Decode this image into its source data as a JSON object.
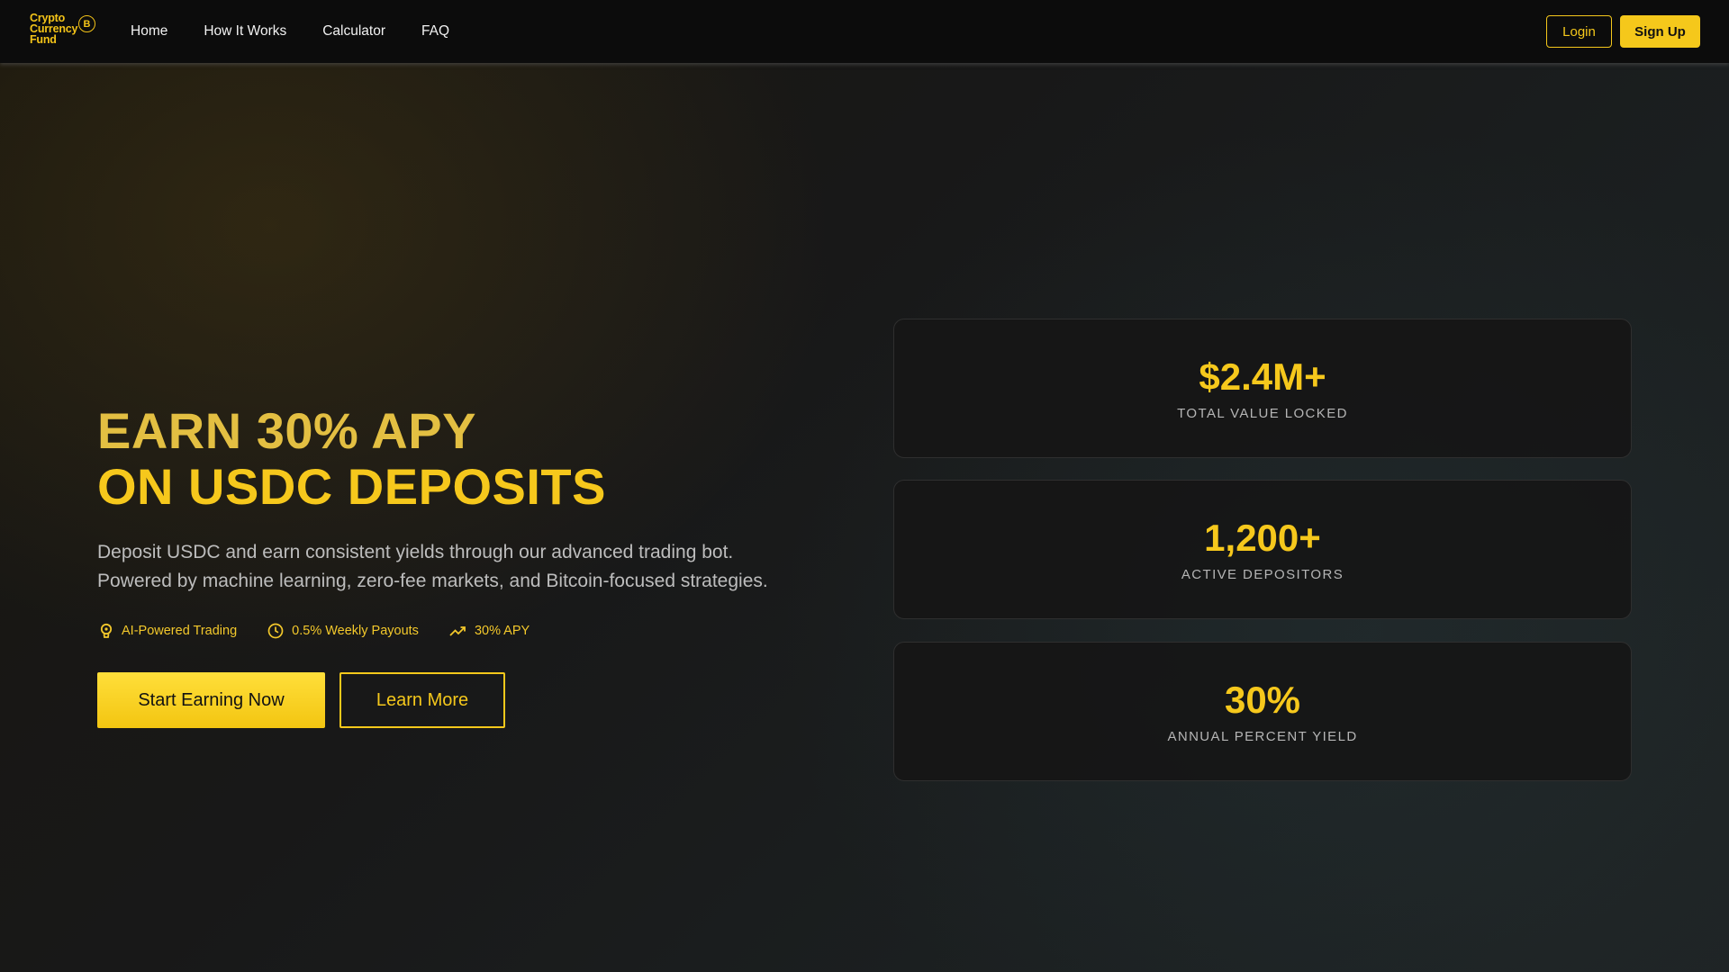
{
  "brand": {
    "logo_lines": [
      "Crypto",
      "Currency",
      "Fund"
    ],
    "coin_glyph": "B",
    "accent_color": "#f5c81b"
  },
  "nav": {
    "links": [
      "Home",
      "How It Works",
      "Calculator",
      "FAQ"
    ],
    "login_label": "Login",
    "signup_label": "Sign Up"
  },
  "hero": {
    "title_line1": "EARN 30% APY",
    "title_line2": "ON USDC DEPOSITS",
    "subtitle_line1": "Deposit USDC and earn consistent yields through our advanced trading bot.",
    "subtitle_line2": "Powered by machine learning, zero-fee markets, and Bitcoin-focused strategies.",
    "features": [
      {
        "icon": "lightbulb-icon",
        "label": "AI-Powered Trading"
      },
      {
        "icon": "clock-icon",
        "label": "0.5% Weekly Payouts"
      },
      {
        "icon": "trending-up-icon",
        "label": "30% APY"
      }
    ],
    "primary_cta": "Start Earning Now",
    "secondary_cta": "Learn More"
  },
  "stats": [
    {
      "value": "$2.4M+",
      "label": "TOTAL VALUE LOCKED"
    },
    {
      "value": "1,200+",
      "label": "ACTIVE DEPOSITORS"
    },
    {
      "value": "30%",
      "label": "ANNUAL PERCENT YIELD"
    }
  ]
}
